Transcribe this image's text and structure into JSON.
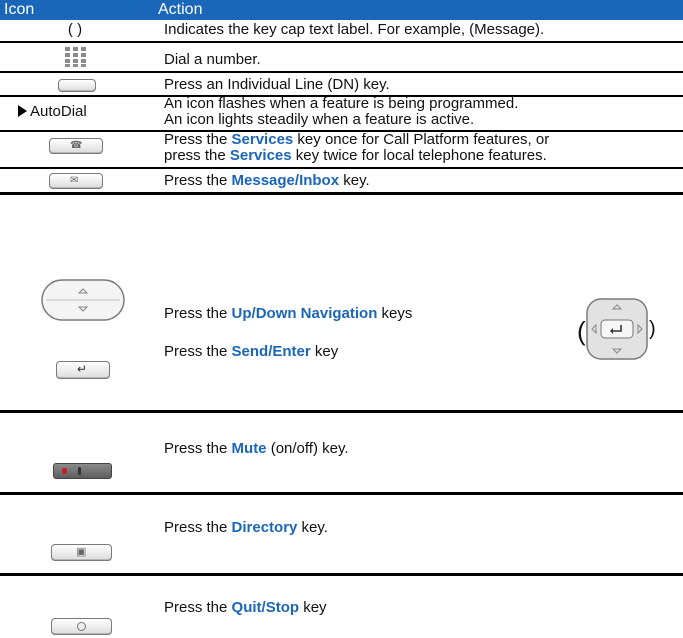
{
  "header": {
    "icon_col": "Icon",
    "action_col": "Action"
  },
  "rows": [
    {
      "icon_text": "(   )",
      "text": "Indicates the key cap text label. For example, (Message)."
    },
    {
      "icon": "dialpad-icon",
      "text": "Dial a number."
    },
    {
      "icon": "line-key-icon",
      "text": "Press an Individual Line (DN) key."
    },
    {
      "icon": "arrow-right-icon",
      "icon_text": "AutoDial",
      "text1": "An icon flashes when a feature is being programmed.",
      "text2": "An icon lights steadily when a feature is active."
    },
    {
      "icon": "services-key-icon",
      "text1_a": "Press the ",
      "text1_b": "Services",
      "text1_c": " key once for Call Platform features, or",
      "text2_a": "press the ",
      "text2_b": "Services",
      "text2_c": " key twice for local telephone features."
    },
    {
      "icon": "message-key-icon",
      "a": "Press the ",
      "b": "Message/Inbox",
      "c": " key."
    },
    {
      "icon": "up-down-nav-icon",
      "a": "Press the ",
      "b": "Up/Down Navigation",
      "c": " keys"
    },
    {
      "icon": "send-enter-key-icon",
      "a": "Press the ",
      "b": "Send/Enter",
      "c": " key"
    },
    {
      "icon": "mute-key-icon",
      "a": "Press the ",
      "b": "Mute",
      "c": " (on/off) key."
    },
    {
      "icon": "directory-key-icon",
      "a": "Press the ",
      "b": "Directory",
      "c": " key."
    },
    {
      "icon": "quit-stop-key-icon",
      "a": "Press the ",
      "b": "Quit/Stop",
      "c": " key"
    }
  ],
  "nav_cluster": {
    "open": "(",
    "close": ")",
    "icon": "navigation-cluster-icon"
  }
}
